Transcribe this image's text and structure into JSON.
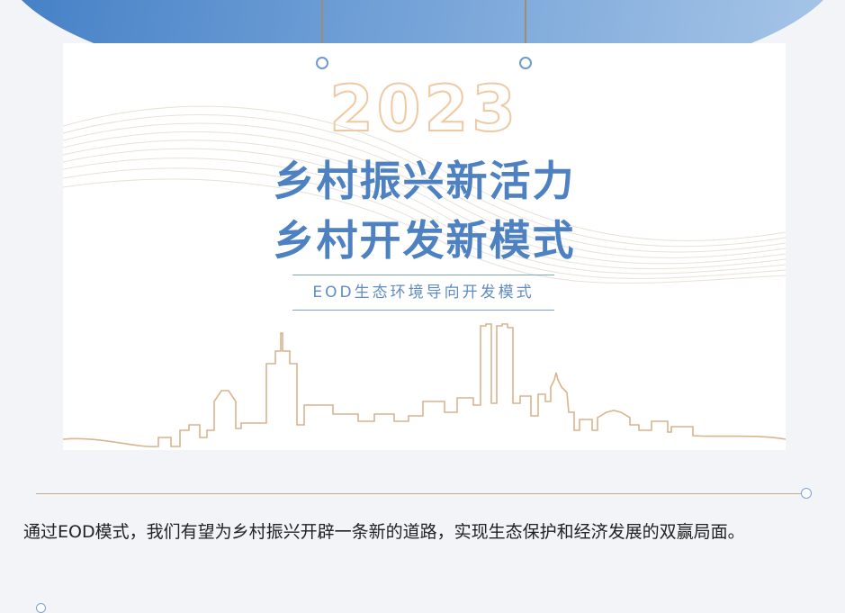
{
  "banner": {
    "year": "2023",
    "headline_line1": "乡村振兴新活力",
    "headline_line2": "乡村开发新模式",
    "subtitle": "EOD生态环境导向开发模式"
  },
  "article": {
    "paragraph": "通过EOD模式，我们有望为乡村振兴开辟一条新的道路，实现生态保护和经济发展的双赢局面。"
  },
  "colors": {
    "accent_blue": "#4d81c2",
    "gold_outline": "#d9b48e",
    "page_background": "#f3f4f8"
  },
  "icons": [
    "hanger-ring-icon",
    "divider-dot-icon",
    "city-skyline-illustration",
    "wave-lines-decoration"
  ]
}
